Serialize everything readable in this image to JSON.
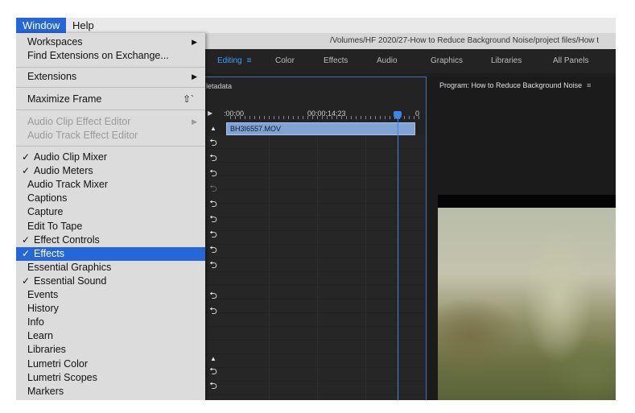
{
  "menubar": {
    "window_label": "Window",
    "help_label": "Help"
  },
  "pathbar": {
    "path": "/Volumes/HF 2020/27-How to Reduce Background Noise/project files/How t"
  },
  "tabs": {
    "editing": "Editing",
    "editing_icon": "≡",
    "color": "Color",
    "effects": "Effects",
    "audio": "Audio",
    "graphics": "Graphics",
    "libraries": "Libraries",
    "all_panels": "All Panels"
  },
  "timeline": {
    "header": "letadata",
    "timecode_start": ":00:00",
    "timecode_mid": "00:00:14:23",
    "timecode_end": "0",
    "clip_name": "BH3I6557.MOV"
  },
  "program": {
    "title": "Program: How to Reduce Background Noise",
    "menu_icon": "≡"
  },
  "window_menu": {
    "workspaces": "Workspaces",
    "find_extensions": "Find Extensions on Exchange...",
    "extensions": "Extensions",
    "maximize_frame": "Maximize Frame",
    "maximize_shortcut": "⇧`",
    "audio_clip_effect_editor": "Audio Clip Effect Editor",
    "audio_track_effect_editor": "Audio Track Effect Editor",
    "items": [
      {
        "label": "Audio Clip Mixer",
        "checked": true
      },
      {
        "label": "Audio Meters",
        "checked": true
      },
      {
        "label": "Audio Track Mixer",
        "checked": false
      },
      {
        "label": "Captions",
        "checked": false
      },
      {
        "label": "Capture",
        "checked": false
      },
      {
        "label": "Edit To Tape",
        "checked": false
      },
      {
        "label": "Effect Controls",
        "checked": true
      },
      {
        "label": "Effects",
        "checked": true
      },
      {
        "label": "Essential Graphics",
        "checked": false
      },
      {
        "label": "Essential Sound",
        "checked": true
      },
      {
        "label": "Events",
        "checked": false
      },
      {
        "label": "History",
        "checked": false
      },
      {
        "label": "Info",
        "checked": false
      },
      {
        "label": "Learn",
        "checked": false
      },
      {
        "label": "Libraries",
        "checked": false
      },
      {
        "label": "Lumetri Color",
        "checked": false
      },
      {
        "label": "Lumetri Scopes",
        "checked": false
      },
      {
        "label": "Markers",
        "checked": false
      }
    ],
    "check_glyph": "✓",
    "submenu_arrow": "▶"
  },
  "colors": {
    "selection": "#2567d6",
    "accent": "#3aa0ff",
    "clip": "#7fa3d3"
  }
}
